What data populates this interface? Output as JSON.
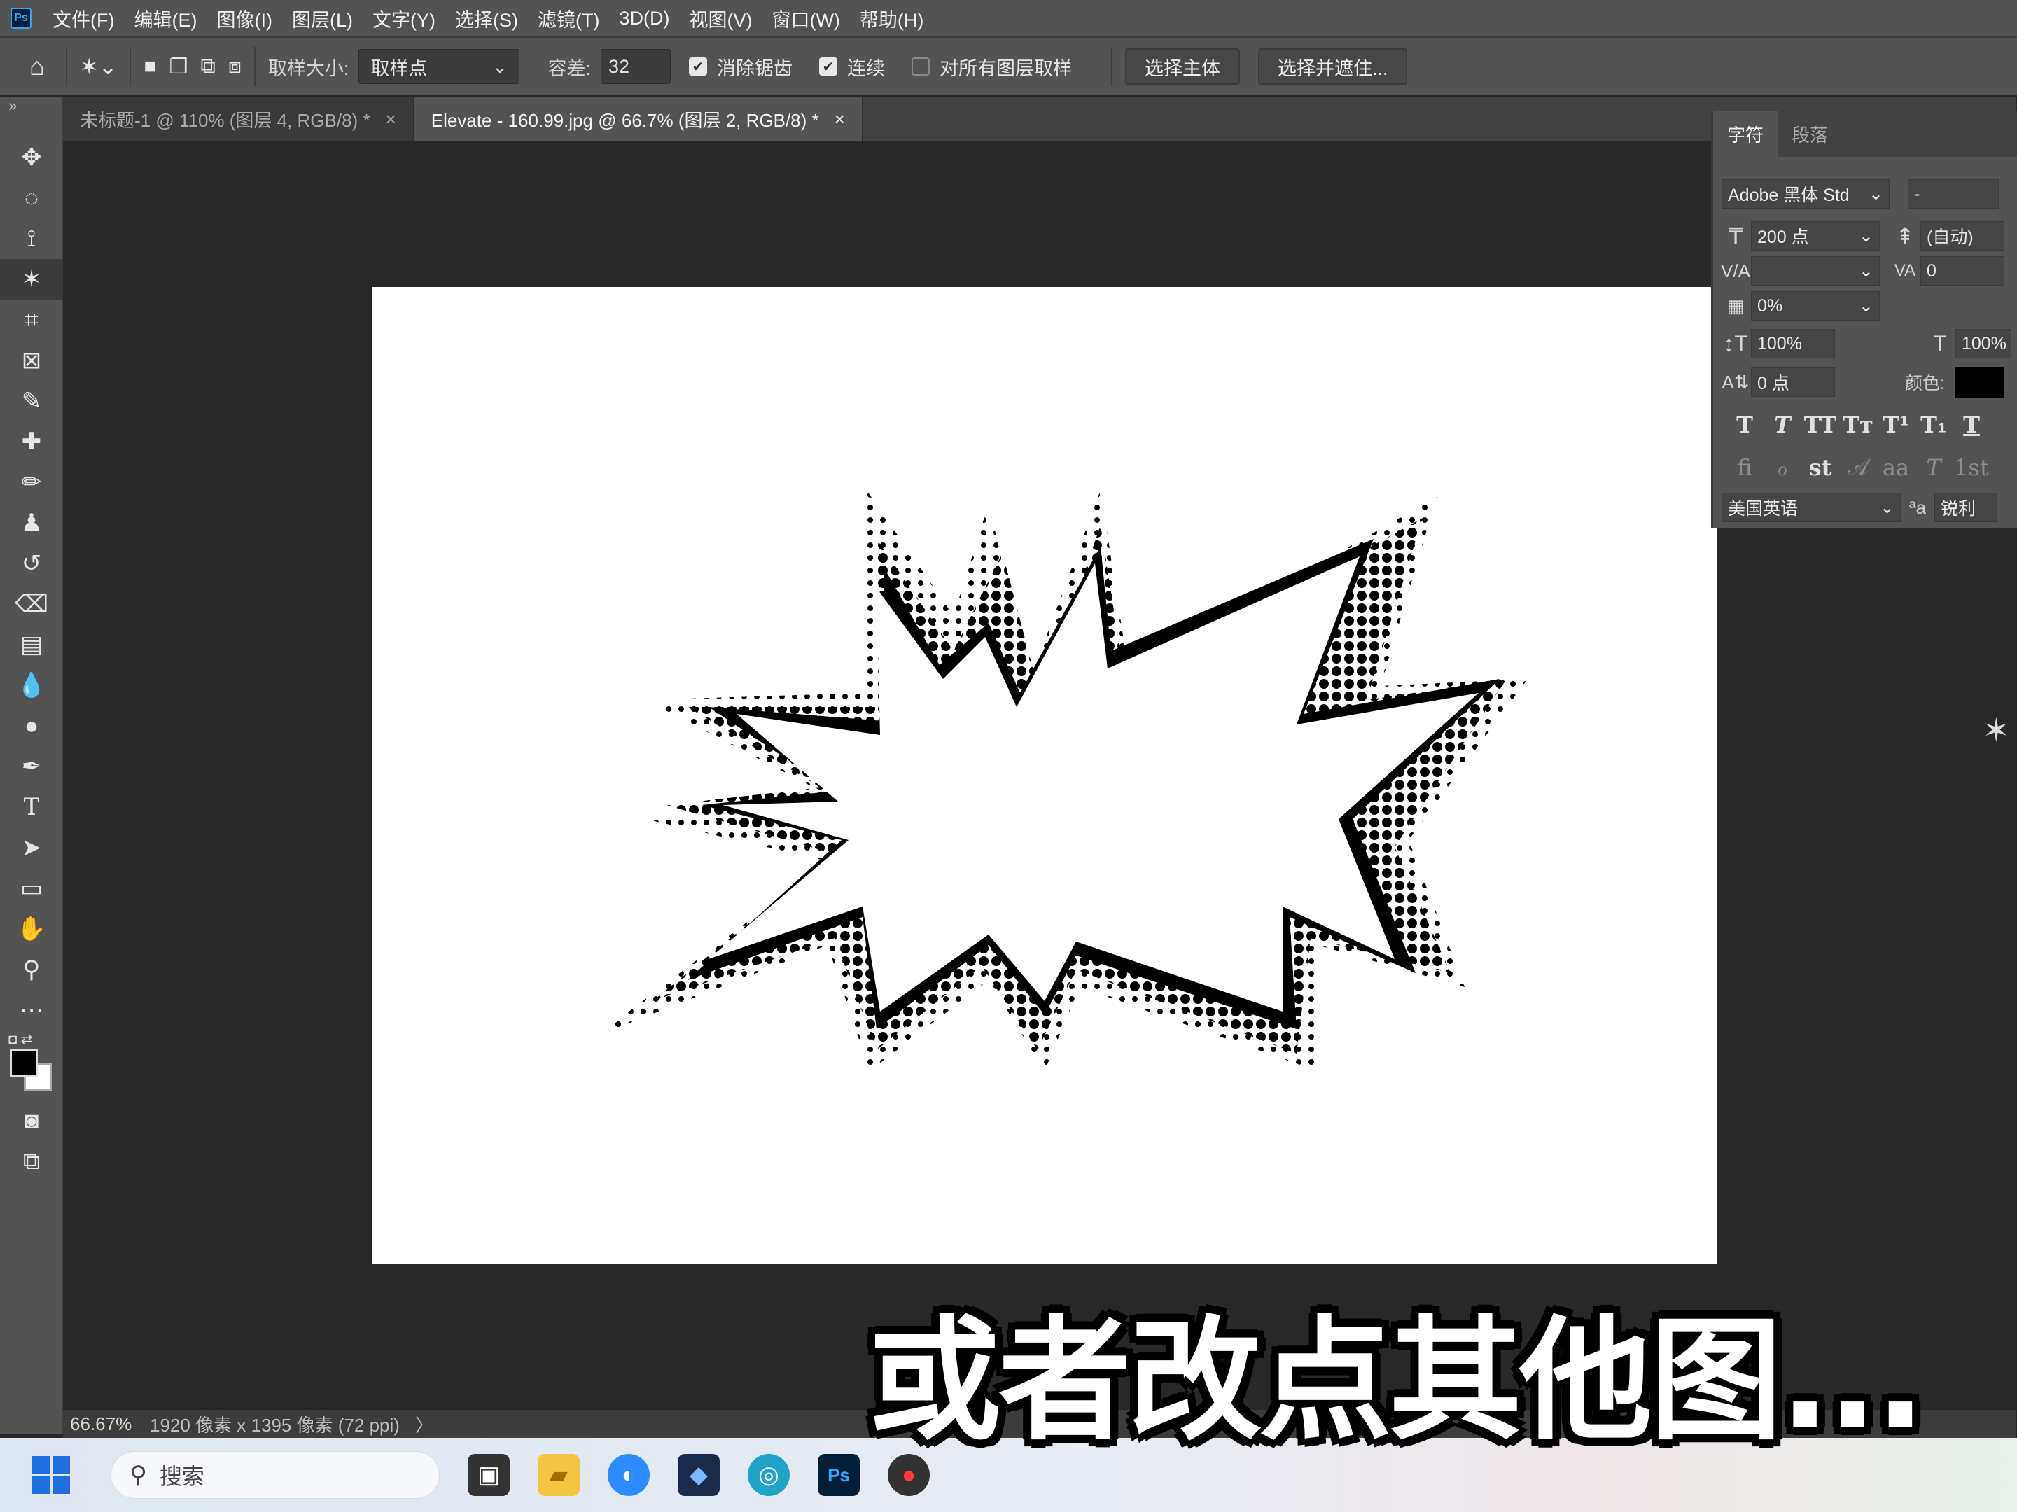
{
  "app": {
    "logo": "Ps"
  },
  "menu": [
    "文件(F)",
    "编辑(E)",
    "图像(I)",
    "图层(L)",
    "文字(Y)",
    "选择(S)",
    "滤镜(T)",
    "3D(D)",
    "视图(V)",
    "窗口(W)",
    "帮助(H)"
  ],
  "options": {
    "sample_size_label": "取样大小:",
    "sample_size_value": "取样点",
    "tolerance_label": "容差:",
    "tolerance_value": "32",
    "anti_alias_label": "消除锯齿",
    "contiguous_label": "连续",
    "all_layers_label": "对所有图层取样",
    "select_subject": "选择主体",
    "select_mask": "选择并遮住..."
  },
  "tabs": [
    {
      "label": "未标题-1 @ 110% (图层 4, RGB/8) *",
      "close": "×"
    },
    {
      "label": "Elevate - 160.99.jpg @ 66.7% (图层 2, RGB/8) *",
      "close": "×"
    }
  ],
  "character_panel": {
    "tab_char": "字符",
    "tab_para": "段落",
    "font_family": "Adobe 黑体 Std",
    "font_style": "-",
    "font_size": "200 点",
    "leading": "(自动)",
    "tracking": "0",
    "scale_pct": "0%",
    "vertical_scale": "100%",
    "horizontal_scale": "100%",
    "baseline_shift": "0 点",
    "color_label": "颜色:",
    "language": "美国英语",
    "aa_icon": "ªa",
    "antialias": "锐利"
  },
  "status": {
    "zoom": "66.67%",
    "doc_info": "1920 像素 x 1395 像素 (72 ppi)",
    "arrow": "〉"
  },
  "taskbar": {
    "search_placeholder": "搜索"
  },
  "caption": "或者改点其他图..."
}
